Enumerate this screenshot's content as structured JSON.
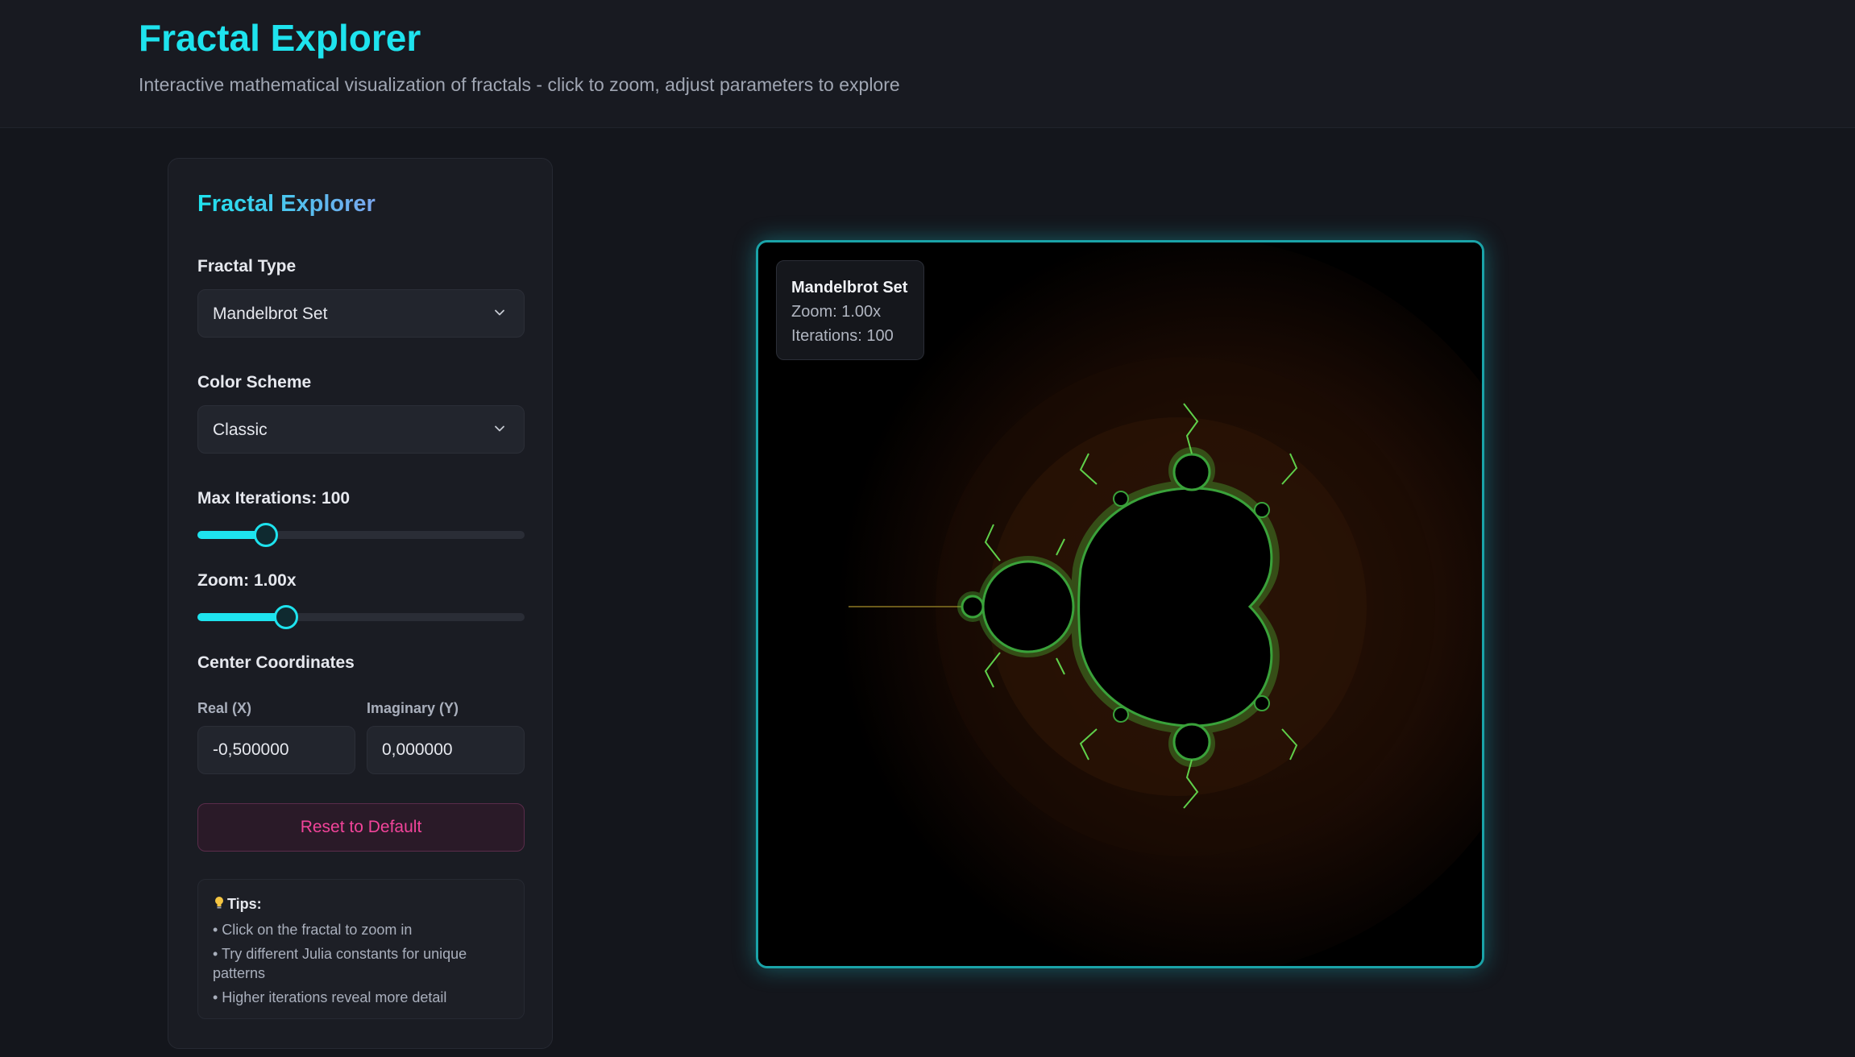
{
  "header": {
    "title": "Fractal Explorer",
    "subtitle": "Interactive mathematical visualization of fractals - click to zoom, adjust parameters to explore"
  },
  "controls": {
    "title": "Fractal Explorer",
    "fractal_type": {
      "label": "Fractal Type",
      "value": "Mandelbrot Set"
    },
    "color_scheme": {
      "label": "Color Scheme",
      "value": "Classic"
    },
    "max_iterations": {
      "label": "Max Iterations: 100",
      "level_percent": 21
    },
    "zoom": {
      "label": "Zoom: 1.00x",
      "level_percent": 27
    },
    "center": {
      "label": "Center Coordinates",
      "real_label": "Real (X)",
      "real_value": "-0,500000",
      "imag_label": "Imaginary (Y)",
      "imag_value": "0,000000"
    },
    "reset_label": "Reset to Default",
    "tips": {
      "title": "Tips:",
      "items": [
        "• Click on the fractal to zoom in",
        "• Try different Julia constants for unique patterns",
        "• Higher iterations reveal more detail"
      ]
    }
  },
  "canvas": {
    "info_title": "Mandelbrot Set",
    "info_zoom": "Zoom: 1.00x",
    "info_iterations": "Iterations: 100"
  },
  "colors": {
    "accent": "#1ee3ee",
    "reset": "#f2449a",
    "set_interior": "#000000",
    "fractal_edge": "#4fbf3a"
  }
}
